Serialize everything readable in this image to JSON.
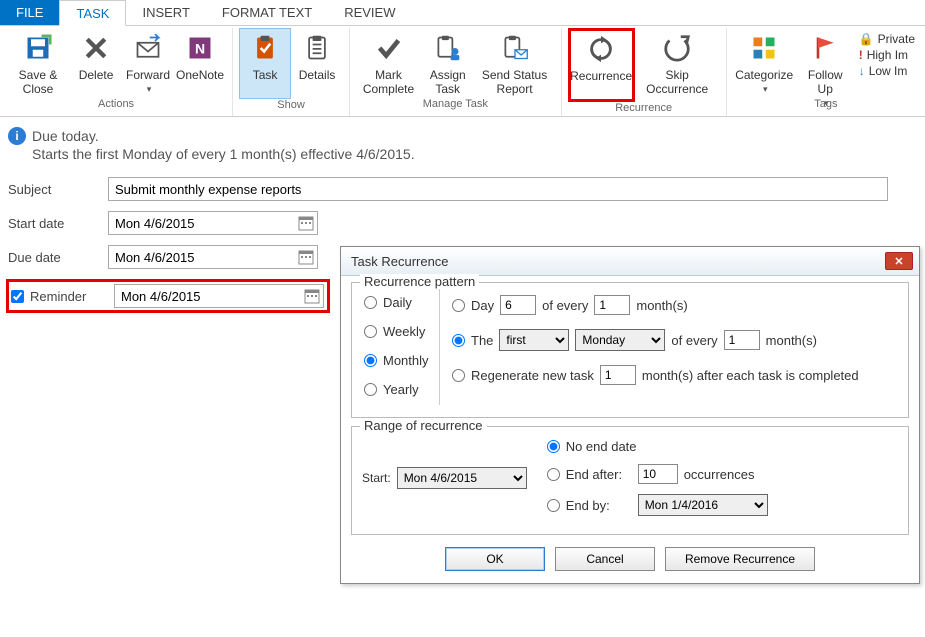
{
  "tabs": {
    "file": "FILE",
    "task": "TASK",
    "insert": "INSERT",
    "format": "FORMAT TEXT",
    "review": "REVIEW"
  },
  "ribbon": {
    "saveClose": "Save & Close",
    "delete": "Delete",
    "forward": "Forward",
    "onenote": "OneNote",
    "task": "Task",
    "details": "Details",
    "markComplete": "Mark Complete",
    "assignTask": "Assign Task",
    "sendStatus": "Send Status Report",
    "recurrence": "Recurrence",
    "skipOccurrence": "Skip Occurrence",
    "categorize": "Categorize",
    "followUp": "Follow Up",
    "private": "Private",
    "highIm": "High Im",
    "lowIm": "Low Im",
    "groups": {
      "actions": "Actions",
      "show": "Show",
      "manage": "Manage Task",
      "recurrence": "Recurrence",
      "tags": "Tags"
    }
  },
  "info": {
    "line1": "Due today.",
    "line2": "Starts the first Monday of every 1 month(s) effective 4/6/2015."
  },
  "form": {
    "subjectLabel": "Subject",
    "subjectValue": "Submit monthly expense reports",
    "startLabel": "Start date",
    "startValue": "Mon 4/6/2015",
    "dueLabel": "Due date",
    "dueValue": "Mon 4/6/2015",
    "reminderLabel": "Reminder",
    "reminderValue": "Mon 4/6/2015"
  },
  "dialog": {
    "title": "Task Recurrence",
    "patternLegend": "Recurrence pattern",
    "daily": "Daily",
    "weekly": "Weekly",
    "monthly": "Monthly",
    "yearly": "Yearly",
    "dayLabel": "Day",
    "dayNum": "6",
    "dayEvery": "of every",
    "dayMonthNum": "1",
    "monthsSuffix": "month(s)",
    "theLabel": "The",
    "ordinal": "first",
    "weekday": "Monday",
    "theEvery": "of every",
    "theMonthNum": "1",
    "regen": "Regenerate new task",
    "regenNum": "1",
    "regenSuffix": "month(s) after each task is completed",
    "rangeLegend": "Range of recurrence",
    "startLabel": "Start:",
    "startDate": "Mon 4/6/2015",
    "noEnd": "No end date",
    "endAfter": "End after:",
    "endAfterNum": "10",
    "occurrences": "occurrences",
    "endBy": "End by:",
    "endByDate": "Mon 1/4/2016",
    "ok": "OK",
    "cancel": "Cancel",
    "remove": "Remove Recurrence"
  }
}
